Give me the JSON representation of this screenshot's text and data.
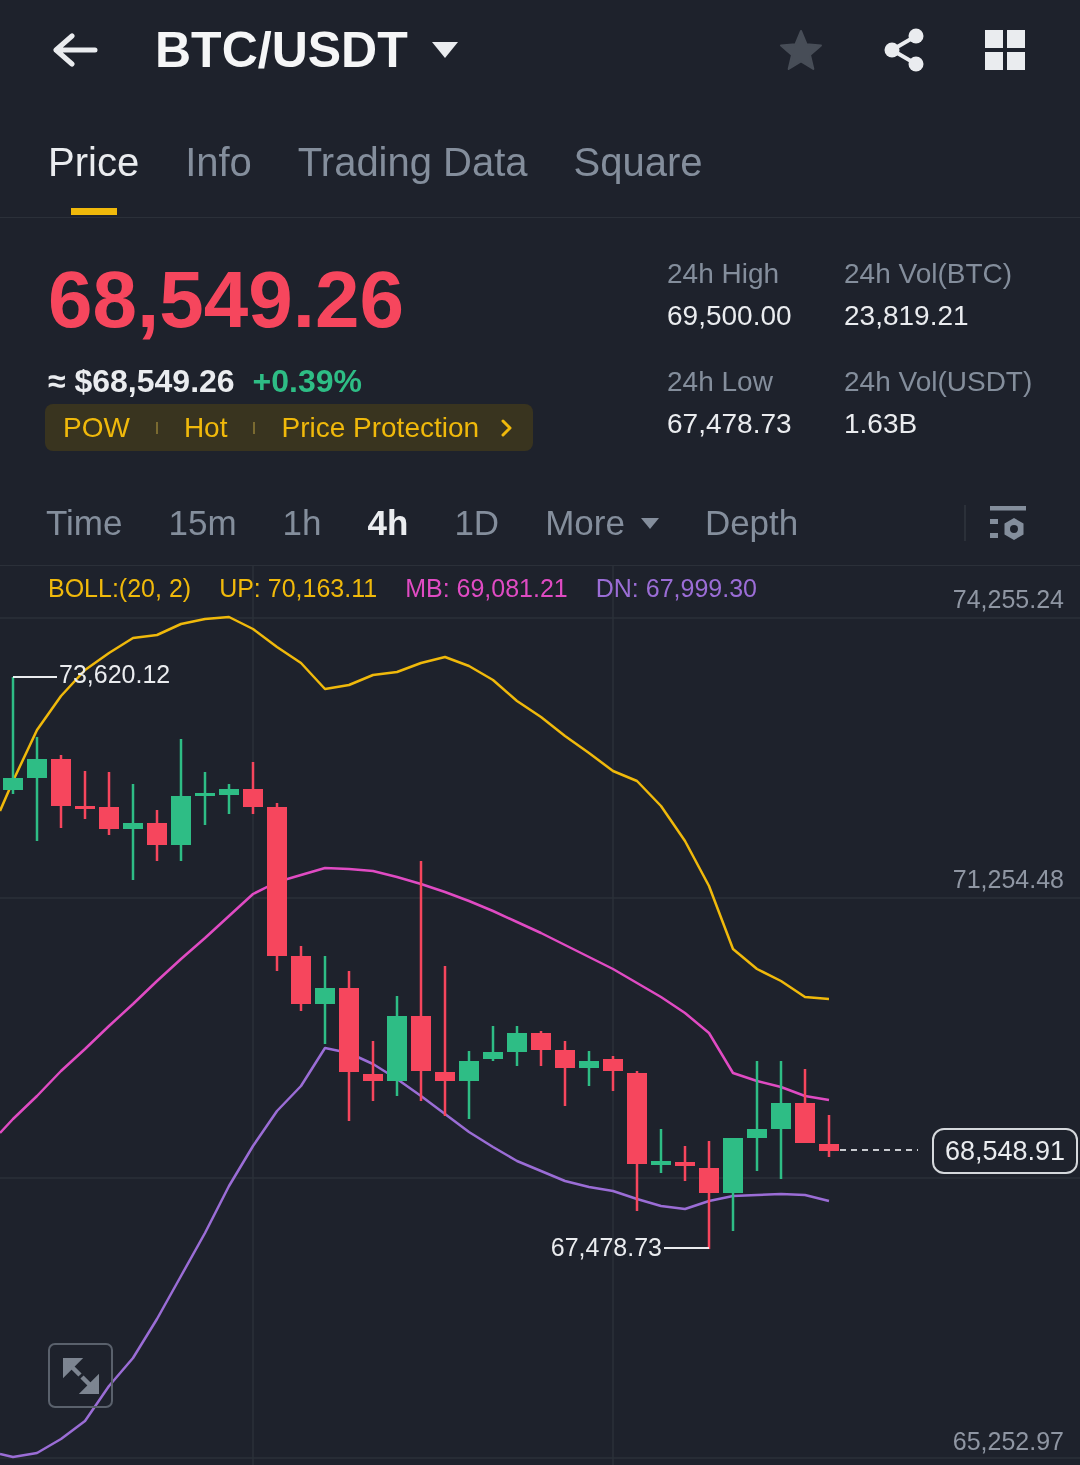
{
  "header": {
    "title": "BTC/USDT",
    "starred": false
  },
  "tabs": [
    {
      "label": "Price",
      "selected": true
    },
    {
      "label": "Info",
      "selected": false
    },
    {
      "label": "Trading Data",
      "selected": false
    },
    {
      "label": "Square",
      "selected": false
    }
  ],
  "ticker": {
    "last_price": "68,549.26",
    "fiat_price": "≈ $68,549.26",
    "change": "+0.39%",
    "tags": [
      "POW",
      "Hot",
      "Price Protection"
    ]
  },
  "stats": [
    {
      "label": "24h High",
      "value": "69,500.00"
    },
    {
      "label": "24h Vol(BTC)",
      "value": "23,819.21"
    },
    {
      "label": "24h Low",
      "value": "67,478.73"
    },
    {
      "label": "24h Vol(USDT)",
      "value": "1.63B"
    }
  ],
  "intervals": [
    {
      "label": "Time",
      "kind": "option",
      "selected": false
    },
    {
      "label": "15m",
      "kind": "option",
      "selected": false
    },
    {
      "label": "1h",
      "kind": "option",
      "selected": false
    },
    {
      "label": "4h",
      "kind": "option",
      "selected": true
    },
    {
      "label": "1D",
      "kind": "option",
      "selected": false
    },
    {
      "label": "More",
      "kind": "menu",
      "selected": false
    },
    {
      "label": "Depth",
      "kind": "option",
      "selected": false
    }
  ],
  "chart": {
    "legend": [
      {
        "text": "BOLL:(20, 2)",
        "color": "#f0b90b"
      },
      {
        "text": "UP: 70,163.11",
        "color": "#f0b90b"
      },
      {
        "text": "MB: 69,081.21",
        "color": "#e04bc3"
      },
      {
        "text": "DN: 67,999.30",
        "color": "#9b6dd6"
      }
    ],
    "y_axis": [
      "74,255.24",
      "71,254.48",
      "65,252.97"
    ],
    "high_label": "73,620.12",
    "low_label": "67,478.73",
    "last_price": "68,548.91"
  }
}
